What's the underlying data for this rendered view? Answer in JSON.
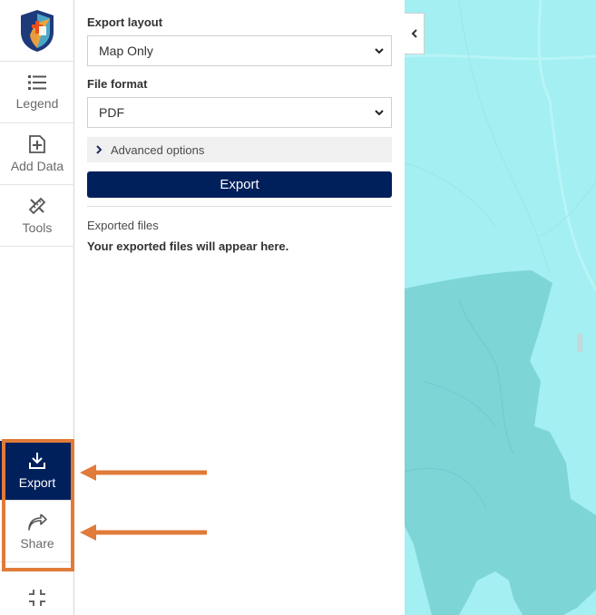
{
  "rail": {
    "logo_icon": "shield-cross-logo",
    "items": [
      {
        "label": "Legend",
        "icon": "list-icon"
      },
      {
        "label": "Add Data",
        "icon": "add-data-icon"
      },
      {
        "label": "Tools",
        "icon": "tools-icon"
      },
      {
        "label": "Export",
        "icon": "download-icon",
        "active": true
      },
      {
        "label": "Share",
        "icon": "share-icon"
      }
    ],
    "collapse_icon": "collapse-icon"
  },
  "panel": {
    "export_layout_label": "Export layout",
    "export_layout_value": "Map Only",
    "file_format_label": "File format",
    "file_format_value": "PDF",
    "advanced_label": "Advanced options",
    "export_button": "Export",
    "exported_files_label": "Exported files",
    "empty_message": "Your exported files will appear here."
  },
  "colors": {
    "brand_navy": "#00205b",
    "annotation_orange": "#e07b39",
    "map_water": "#a3eff2",
    "map_region": "#7ed5d6"
  }
}
